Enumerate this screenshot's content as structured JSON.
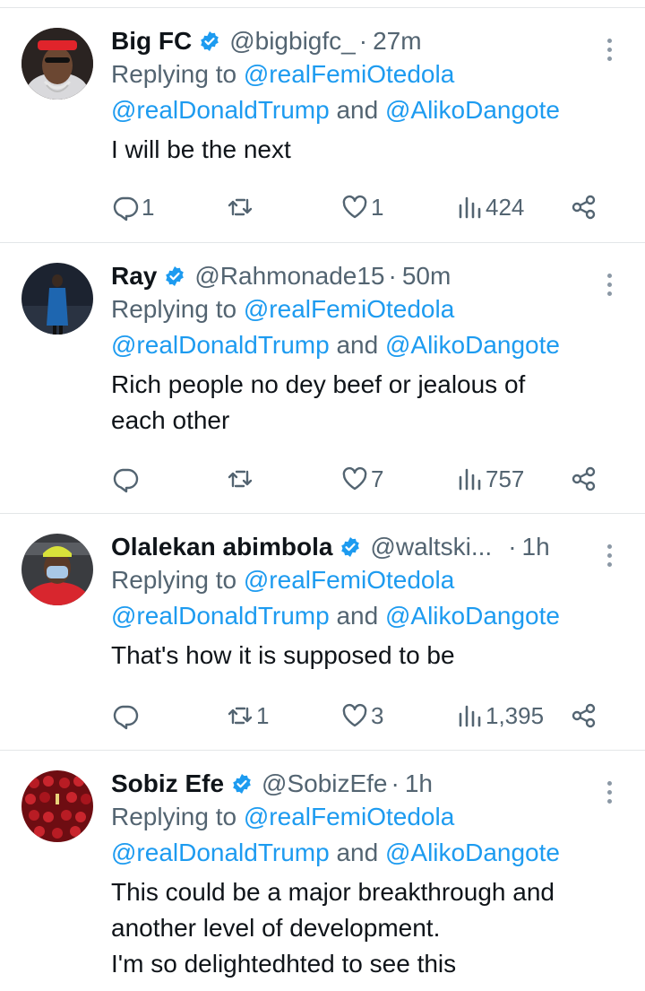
{
  "tweets": [
    {
      "name": "Big FC",
      "handle": "@bigbigfc_",
      "time": "27m",
      "replying_prefix": "Replying to ",
      "mention1": "@realFemiOtedola",
      "mention2": "@realDonaldTrump",
      "and_word": " and ",
      "mention3": "@AlikoDangote",
      "text_lines": [
        "I will be the next"
      ],
      "replies": "1",
      "retweets": "",
      "likes": "1",
      "views": "424"
    },
    {
      "name": "Ray",
      "handle": "@Rahmonade15",
      "time": "50m",
      "replying_prefix": "Replying to ",
      "mention1": "@realFemiOtedola",
      "mention2": "@realDonaldTrump",
      "and_word": " and ",
      "mention3": "@AlikoDangote",
      "text_lines": [
        "Rich people no dey beef or jealous of",
        "each other"
      ],
      "replies": "",
      "retweets": "",
      "likes": "7",
      "views": "757"
    },
    {
      "name": "Olalekan abimbola",
      "handle": "@waltski...",
      "time": "1h",
      "replying_prefix": "Replying to ",
      "mention1": "@realFemiOtedola",
      "mention2": "@realDonaldTrump",
      "and_word": " and ",
      "mention3": "@AlikoDangote",
      "text_lines": [
        "That's how it is supposed to be"
      ],
      "replies": "",
      "retweets": "1",
      "likes": "3",
      "views": "1,395"
    },
    {
      "name": "Sobiz Efe",
      "handle": "@SobizEfe",
      "time": "1h",
      "replying_prefix": "Replying to ",
      "mention1": "@realFemiOtedola",
      "mention2": "@realDonaldTrump",
      "and_word": " and ",
      "mention3": "@AlikoDangote",
      "text_lines": [
        "This could be a major breakthrough and",
        "another level of development.",
        "I'm so delightedhted to see this"
      ],
      "replies": "",
      "retweets": "",
      "likes": "",
      "views": ""
    }
  ],
  "time_separator": "·",
  "colors": {
    "link": "#1d9bf0",
    "muted": "#536471",
    "verified_badge": "#1d9bf0",
    "divider": "#e3e6e8"
  },
  "icons": [
    "verified-badge-icon",
    "more-options-icon",
    "reply-icon",
    "retweet-icon",
    "like-icon",
    "views-icon",
    "share-icon"
  ]
}
